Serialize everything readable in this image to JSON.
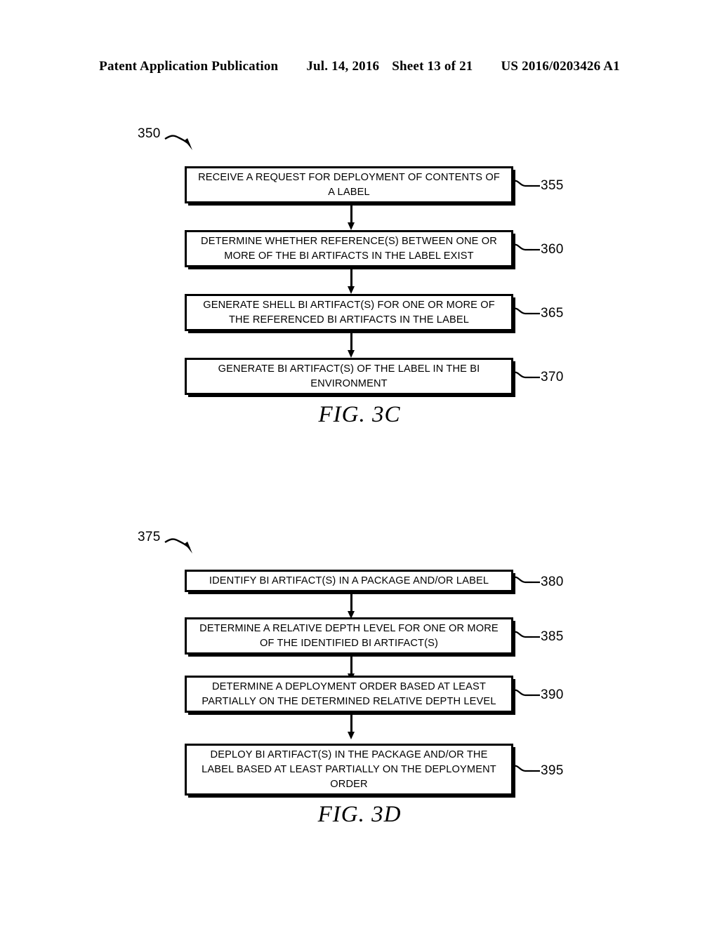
{
  "header": {
    "publication": "Patent Application Publication",
    "date": "Jul. 14, 2016",
    "sheet": "Sheet 13 of 21",
    "patent_number": "US 2016/0203426 A1"
  },
  "figures": [
    {
      "id": "3c",
      "caption": "FIG. 3C",
      "flow_tag": "350",
      "steps": [
        {
          "ref": "355",
          "text": "RECEIVE A REQUEST FOR DEPLOYMENT OF CONTENTS OF A LABEL"
        },
        {
          "ref": "360",
          "text": "DETERMINE WHETHER REFERENCE(S) BETWEEN ONE OR MORE OF THE BI ARTIFACTS IN THE LABEL EXIST"
        },
        {
          "ref": "365",
          "text": "GENERATE SHELL BI ARTIFACT(S) FOR ONE OR MORE OF THE REFERENCED BI ARTIFACTS IN THE LABEL"
        },
        {
          "ref": "370",
          "text": "GENERATE BI ARTIFACT(S) OF THE LABEL IN THE BI ENVIRONMENT"
        }
      ]
    },
    {
      "id": "3d",
      "caption": "FIG. 3D",
      "flow_tag": "375",
      "steps": [
        {
          "ref": "380",
          "text": "IDENTIFY BI ARTIFACT(S) IN A PACKAGE AND/OR LABEL"
        },
        {
          "ref": "385",
          "text": "DETERMINE A RELATIVE DEPTH LEVEL FOR ONE OR MORE OF THE IDENTIFIED BI ARTIFACT(S)"
        },
        {
          "ref": "390",
          "text": "DETERMINE A DEPLOYMENT ORDER BASED AT LEAST PARTIALLY ON THE DETERMINED RELATIVE DEPTH LEVEL"
        },
        {
          "ref": "395",
          "text": "DEPLOY BI ARTIFACT(S) IN THE PACKAGE AND/OR THE LABEL BASED AT LEAST PARTIALLY ON THE DEPLOYMENT ORDER"
        }
      ]
    }
  ]
}
